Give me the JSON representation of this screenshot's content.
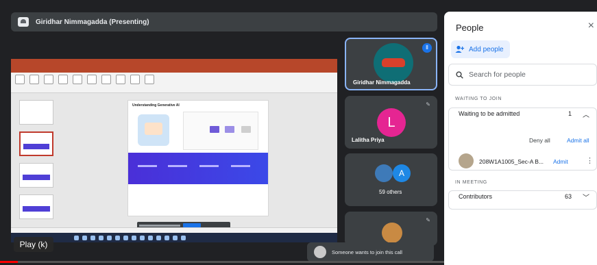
{
  "presenter_bar": {
    "title": "Giridhar Nimmagadda (Presenting)"
  },
  "participants": [
    {
      "name": "Giridhar Nimmagadda"
    },
    {
      "name": "Lalitha Priya",
      "initial": "L"
    },
    {
      "name": "59 others",
      "initial": "A"
    },
    {
      "name": ""
    }
  ],
  "shared_slide": {
    "title": "Understanding Generative AI"
  },
  "player": {
    "play_label": "Play (k)",
    "progress": 0.03
  },
  "toast": {
    "text": "Someone wants to join this call"
  },
  "panel": {
    "title": "People",
    "close_glyph": "×",
    "add_people_label": "Add people",
    "search_placeholder": "Search for people",
    "waiting_section_label": "WAITING TO JOIN",
    "waiting_row_label": "Waiting to be admitted",
    "waiting_count": "1",
    "deny_all_label": "Deny all",
    "admit_all_label": "Admit all",
    "request_name": "208W1A1005_Sec-A B...",
    "admit_label": "Admit",
    "in_meeting_label": "IN MEETING",
    "contributors_label": "Contributors",
    "contributors_count": "63"
  },
  "colors": {
    "accent": "#1a73e8",
    "speaking": "#8ab4f8",
    "progress": "#ff0000"
  }
}
